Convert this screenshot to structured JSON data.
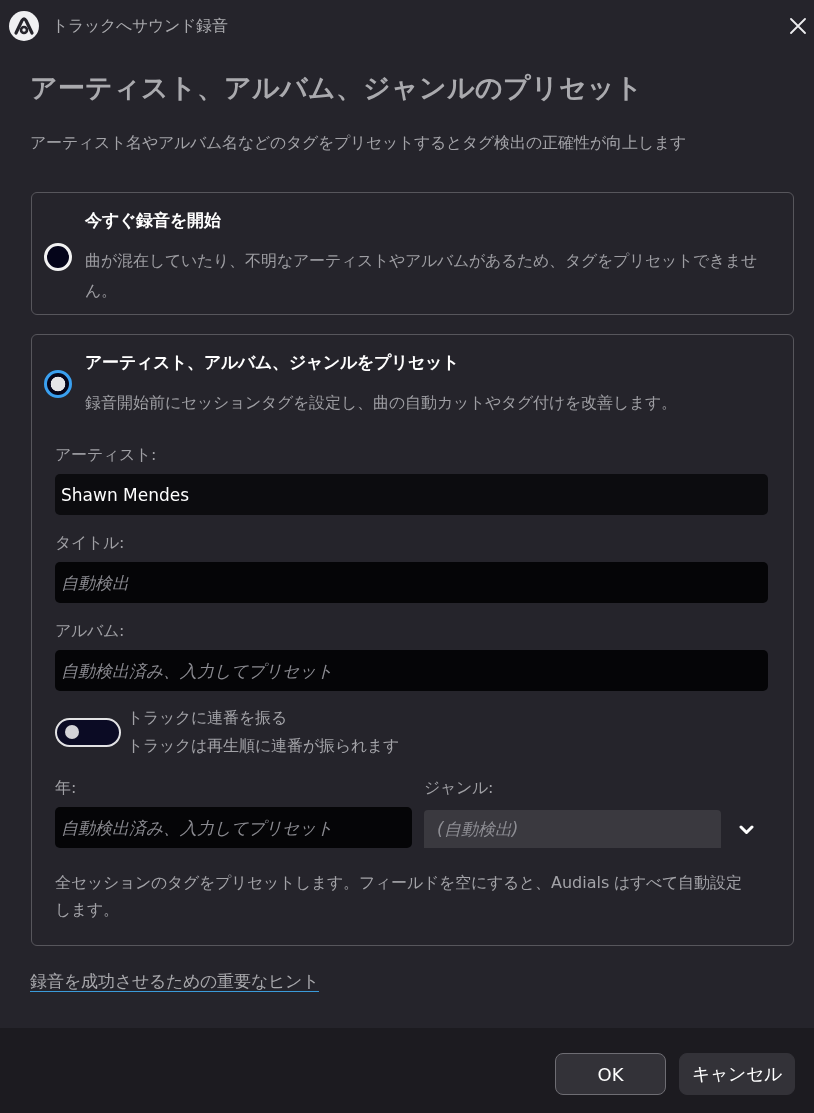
{
  "window": {
    "title": "トラックへサウンド録音"
  },
  "heading": "アーティスト、アルバム、ジャンルのプリセット",
  "subtitle": "アーティスト名やアルバム名などのタグをプリセットするとタグ検出の正確性が向上します",
  "options": [
    {
      "title": "今すぐ録音を開始",
      "description": "曲が混在していたり、不明なアーティストやアルバムがあるため、タグをプリセットできません。",
      "selected": false
    },
    {
      "title": "アーティスト、アルバム、ジャンルをプリセット",
      "description": "録音開始前にセッションタグを設定し、曲の自動カットやタグ付けを改善します。",
      "selected": true,
      "form": {
        "fields": [
          {
            "label": "アーティスト:",
            "value": "Shawn Mendes"
          },
          {
            "label": "タイトル:",
            "placeholder": "自動検出"
          },
          {
            "label": "アルバム:",
            "placeholder": "自動検出済み、入力してプリセット"
          }
        ],
        "toggle": {
          "label": "トラックに連番を振る",
          "hint": "トラックは再生順に連番が振られます",
          "on": false
        },
        "year": {
          "label": "年:",
          "placeholder": "自動検出済み、入力してプリセット"
        },
        "genre": {
          "label": "ジャンル:",
          "placeholder": "(自動検出)"
        },
        "note": "全セッションのタグをプリセットします。フィールドを空にすると、Audials はすべて自動設定します。"
      }
    }
  ],
  "link": "録音を成功させるための重要なヒント",
  "buttons": [
    {
      "label": "OK",
      "kind": "primary"
    },
    {
      "label": "キャンセル",
      "kind": "secondary"
    }
  ]
}
